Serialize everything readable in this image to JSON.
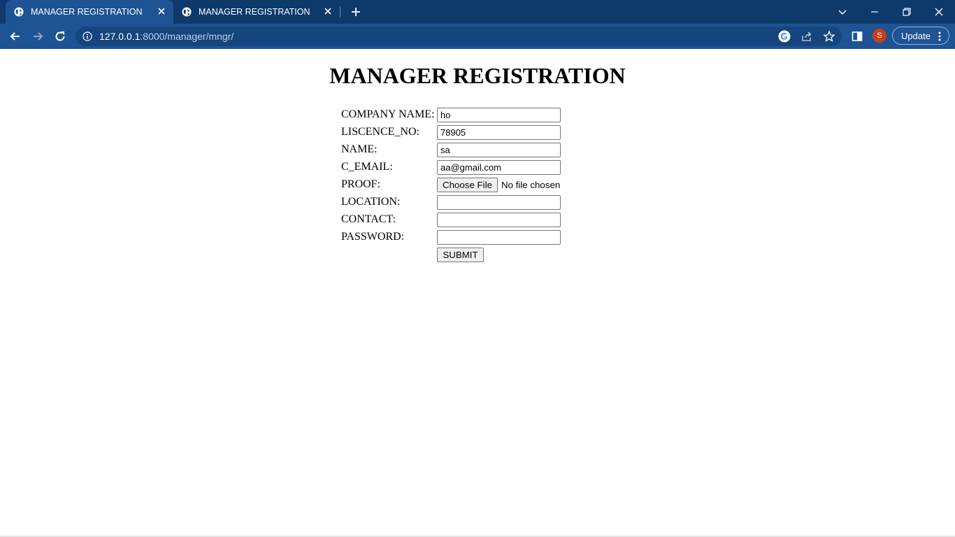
{
  "browser": {
    "tabs": [
      {
        "title": "MANAGER REGISTRATION",
        "active": true
      },
      {
        "title": "MANAGER REGISTRATION",
        "active": false
      }
    ],
    "url_host": "127.0.0.1",
    "url_rest": ":8000/manager/mngr/",
    "profile_initial": "S",
    "update_label": "Update",
    "colors": {
      "tabstrip": "#0d3a6b",
      "toolbar": "#1e5394",
      "omnibox": "#16457e",
      "avatar": "#c4401a"
    }
  },
  "page": {
    "title": "MANAGER REGISTRATION",
    "form": {
      "company_name": {
        "label": "COMPANY NAME:",
        "value": "ho"
      },
      "licence_no": {
        "label": "LISCENCE_NO:",
        "value": "78905"
      },
      "name": {
        "label": "NAME:",
        "value": "sa"
      },
      "c_email": {
        "label": "C_EMAIL:",
        "value": "aa@gmail.com"
      },
      "proof": {
        "label": "PROOF:",
        "button": "Choose File",
        "status": "No file chosen"
      },
      "location": {
        "label": "LOCATION:",
        "value": ""
      },
      "contact": {
        "label": "CONTACT:",
        "value": ""
      },
      "password": {
        "label": "PASSWORD:",
        "value": ""
      },
      "submit_label": "SUBMIT"
    }
  }
}
